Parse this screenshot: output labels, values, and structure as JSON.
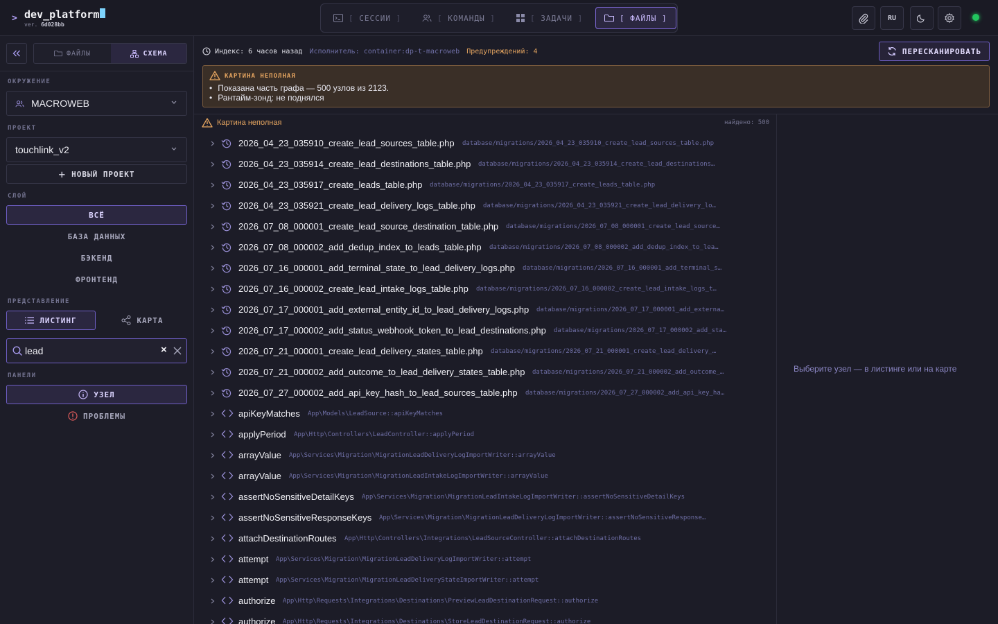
{
  "app": {
    "name": "dev_platform",
    "version_prefix": "ver.",
    "version": "6d028bb"
  },
  "main_tabs": [
    {
      "label": "СЕССИИ",
      "icon": "terminal-icon",
      "active": false
    },
    {
      "label": "КОМАНДЫ",
      "icon": "users-icon",
      "active": false
    },
    {
      "label": "ЗАДАЧИ",
      "icon": "grid-icon",
      "active": false
    },
    {
      "label": "ФАЙЛЫ",
      "icon": "folder-icon",
      "active": true
    }
  ],
  "topbar": {
    "lang": "RU",
    "status_color": "#22c55e"
  },
  "sidebar": {
    "collapse_icon": "double-chevron-left-icon",
    "view_toggle": {
      "files_label": "ФАЙЛЫ",
      "schema_label": "СХЕМА",
      "active": "schema"
    },
    "env_label": "ОКРУЖЕНИЕ",
    "env_value": "MACROWEB",
    "project_label": "ПРОЕКТ",
    "project_value": "touchlink_v2",
    "new_project_label": "НОВЫЙ ПРОЕКТ",
    "layer_label": "СЛОЙ",
    "layers": [
      {
        "label": "ВСЁ",
        "active": true
      },
      {
        "label": "БАЗА ДАННЫХ",
        "active": false
      },
      {
        "label": "БЭКЕНД",
        "active": false
      },
      {
        "label": "ФРОНТЕНД",
        "active": false
      }
    ],
    "view_label": "ПРЕДСТАВЛЕНИЕ",
    "view_listing": "ЛИСТИНГ",
    "view_map": "КАРТА",
    "search_value": "lead",
    "panels_label": "ПАНЕЛИ",
    "panel_node": "УЗЕЛ",
    "panel_problems": "ПРОБЛЕМЫ"
  },
  "infobar": {
    "index_text": "Индекс: 6 часов назад",
    "executor_text": "Исполнитель: container:dp-t-macroweb",
    "warnings_text": "Предупреждений: 4",
    "rescan_label": "ПЕРЕСКАНИРОВАТЬ"
  },
  "warning_box": {
    "title": "КАРТИНА НЕПОЛНАЯ",
    "items": [
      "Показана часть графа — 500 узлов из 2123.",
      "Рантайм-зонд: не поднялся"
    ]
  },
  "list": {
    "warning_label": "Картина неполная",
    "found_text": "найдено: 500",
    "rows": [
      {
        "kind": "migration",
        "name": "2026_04_23_035910_create_lead_sources_table.php",
        "path": "database/migrations/2026_04_23_035910_create_lead_sources_table.php"
      },
      {
        "kind": "migration",
        "name": "2026_04_23_035914_create_lead_destinations_table.php",
        "path": "database/migrations/2026_04_23_035914_create_lead_destinations…"
      },
      {
        "kind": "migration",
        "name": "2026_04_23_035917_create_leads_table.php",
        "path": "database/migrations/2026_04_23_035917_create_leads_table.php"
      },
      {
        "kind": "migration",
        "name": "2026_04_23_035921_create_lead_delivery_logs_table.php",
        "path": "database/migrations/2026_04_23_035921_create_lead_delivery_lo…"
      },
      {
        "kind": "migration",
        "name": "2026_07_08_000001_create_lead_source_destination_table.php",
        "path": "database/migrations/2026_07_08_000001_create_lead_source…"
      },
      {
        "kind": "migration",
        "name": "2026_07_08_000002_add_dedup_index_to_leads_table.php",
        "path": "database/migrations/2026_07_08_000002_add_dedup_index_to_lea…"
      },
      {
        "kind": "migration",
        "name": "2026_07_16_000001_add_terminal_state_to_lead_delivery_logs.php",
        "path": "database/migrations/2026_07_16_000001_add_terminal_s…"
      },
      {
        "kind": "migration",
        "name": "2026_07_16_000002_create_lead_intake_logs_table.php",
        "path": "database/migrations/2026_07_16_000002_create_lead_intake_logs_t…"
      },
      {
        "kind": "migration",
        "name": "2026_07_17_000001_add_external_entity_id_to_lead_delivery_logs.php",
        "path": "database/migrations/2026_07_17_000001_add_externa…"
      },
      {
        "kind": "migration",
        "name": "2026_07_17_000002_add_status_webhook_token_to_lead_destinations.php",
        "path": "database/migrations/2026_07_17_000002_add_sta…"
      },
      {
        "kind": "migration",
        "name": "2026_07_21_000001_create_lead_delivery_states_table.php",
        "path": "database/migrations/2026_07_21_000001_create_lead_delivery_…"
      },
      {
        "kind": "migration",
        "name": "2026_07_21_000002_add_outcome_to_lead_delivery_states_table.php",
        "path": "database/migrations/2026_07_21_000002_add_outcome_…"
      },
      {
        "kind": "migration",
        "name": "2026_07_27_000002_add_api_key_hash_to_lead_sources_table.php",
        "path": "database/migrations/2026_07_27_000002_add_api_key_ha…"
      },
      {
        "kind": "method",
        "name": "apiKeyMatches",
        "path": "App\\Models\\LeadSource::apiKeyMatches"
      },
      {
        "kind": "method",
        "name": "applyPeriod",
        "path": "App\\Http\\Controllers\\LeadController::applyPeriod"
      },
      {
        "kind": "method",
        "name": "arrayValue",
        "path": "App\\Services\\Migration\\MigrationLeadDeliveryLogImportWriter::arrayValue"
      },
      {
        "kind": "method",
        "name": "arrayValue",
        "path": "App\\Services\\Migration\\MigrationLeadIntakeLogImportWriter::arrayValue"
      },
      {
        "kind": "method",
        "name": "assertNoSensitiveDetailKeys",
        "path": "App\\Services\\Migration\\MigrationLeadIntakeLogImportWriter::assertNoSensitiveDetailKeys"
      },
      {
        "kind": "method",
        "name": "assertNoSensitiveResponseKeys",
        "path": "App\\Services\\Migration\\MigrationLeadDeliveryLogImportWriter::assertNoSensitiveResponse…"
      },
      {
        "kind": "method",
        "name": "attachDestinationRoutes",
        "path": "App\\Http\\Controllers\\Integrations\\LeadSourceController::attachDestinationRoutes"
      },
      {
        "kind": "method",
        "name": "attempt",
        "path": "App\\Services\\Migration\\MigrationLeadDeliveryLogImportWriter::attempt"
      },
      {
        "kind": "method",
        "name": "attempt",
        "path": "App\\Services\\Migration\\MigrationLeadDeliveryStateImportWriter::attempt"
      },
      {
        "kind": "method",
        "name": "authorize",
        "path": "App\\Http\\Requests\\Integrations\\Destinations\\PreviewLeadDestinationRequest::authorize"
      },
      {
        "kind": "method",
        "name": "authorize",
        "path": "App\\Http\\Requests\\Integrations\\Destinations\\StoreLeadDestinationRequest::authorize"
      }
    ]
  },
  "detail": {
    "hint": "Выберите узел — в листинге или на карте"
  },
  "colors": {
    "accent": "#7d68d6",
    "warning": "#e8a761",
    "path": "#6f6fa6",
    "background": "#1c1c27"
  }
}
